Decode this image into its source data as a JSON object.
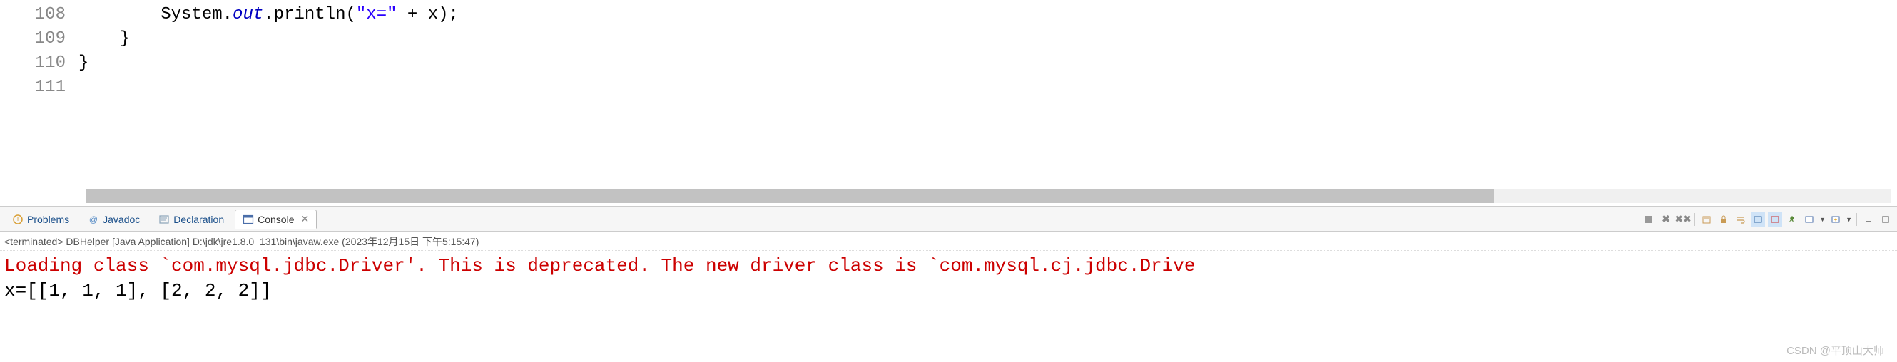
{
  "editor": {
    "lines": [
      {
        "num": "108",
        "indent": "        ",
        "segments": [
          {
            "t": "System.",
            "c": "punct"
          },
          {
            "t": "out",
            "c": "kw-field"
          },
          {
            "t": ".println(",
            "c": "punct"
          },
          {
            "t": "\"x=\"",
            "c": "str"
          },
          {
            "t": " + x);",
            "c": "punct"
          }
        ]
      },
      {
        "num": "109",
        "indent": "    ",
        "segments": [
          {
            "t": "}",
            "c": "punct"
          }
        ]
      },
      {
        "num": "110",
        "indent": "",
        "segments": [
          {
            "t": "}",
            "c": "punct"
          }
        ]
      },
      {
        "num": "111",
        "indent": "",
        "segments": []
      }
    ]
  },
  "tabs": {
    "problems": "Problems",
    "javadoc": "Javadoc",
    "declaration": "Declaration",
    "console": "Console"
  },
  "toolbar_icons": {
    "close_console": "close-console-icon",
    "remove_all": "remove-all-terminated-icon",
    "scroll_lock": "scroll-lock-icon",
    "show_console": "show-console-icon",
    "pin": "pin-console-icon",
    "display": "display-selected-console-icon",
    "open_console": "open-console-icon",
    "min": "minimize-icon",
    "max": "maximize-icon"
  },
  "console": {
    "status": "<terminated> DBHelper [Java Application] D:\\jdk\\jre1.8.0_131\\bin\\javaw.exe (2023年12月15日 下午5:15:47)",
    "lines": [
      {
        "type": "err",
        "text": "Loading class `com.mysql.jdbc.Driver'. This is deprecated. The new driver class is `com.mysql.cj.jdbc.Drive"
      },
      {
        "type": "out",
        "text": "x=[[1, 1, 1], [2, 2, 2]]"
      }
    ]
  },
  "watermark": "CSDN @平顶山大师",
  "chart_data": {
    "type": "table",
    "title": "Console output array x",
    "values": [
      [
        1,
        1,
        1
      ],
      [
        2,
        2,
        2
      ]
    ]
  }
}
